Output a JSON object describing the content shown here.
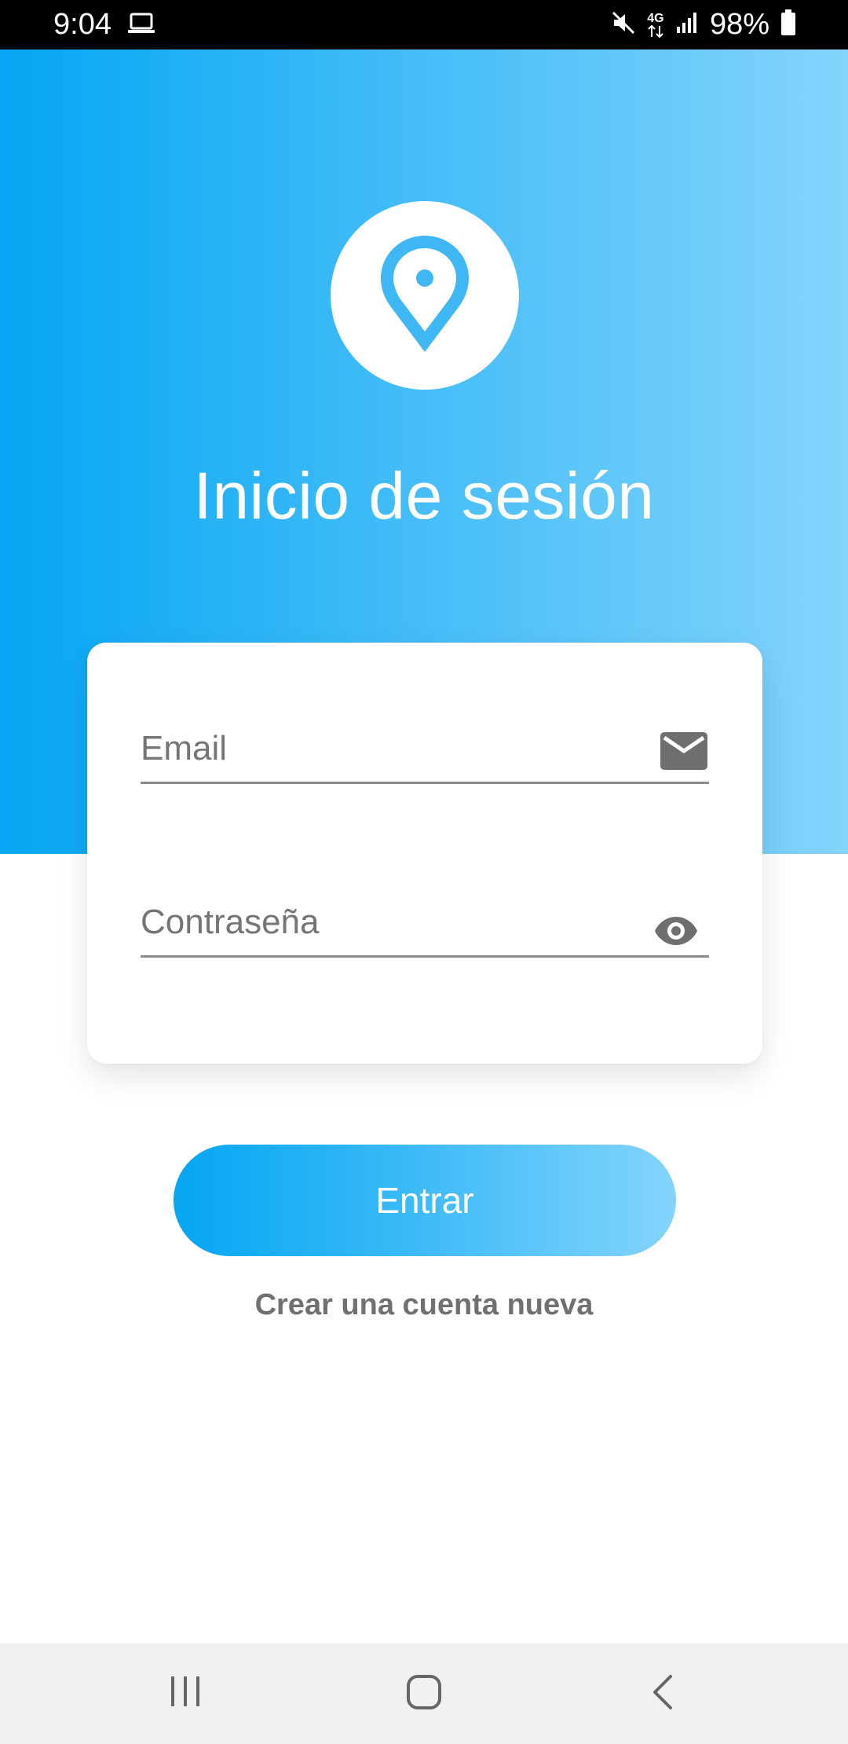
{
  "status_bar": {
    "time": "9:04",
    "network": "4G",
    "battery": "98%",
    "icons": [
      "laptop-icon",
      "mute-icon",
      "4g-icon",
      "signal-icon",
      "battery-icon"
    ]
  },
  "header": {
    "title": "Inicio de sesión",
    "logo_icon": "location-pin-icon"
  },
  "form": {
    "email_placeholder": "Email",
    "email_value": "",
    "password_placeholder": "Contraseña",
    "password_value": ""
  },
  "actions": {
    "submit_label": "Entrar",
    "create_account_label": "Crear una cuenta nueva"
  },
  "colors": {
    "gradient_start": "#05a6f4",
    "gradient_end": "#84d4fc",
    "icon_gray": "#6f6f6f",
    "link_gray": "#707070"
  }
}
